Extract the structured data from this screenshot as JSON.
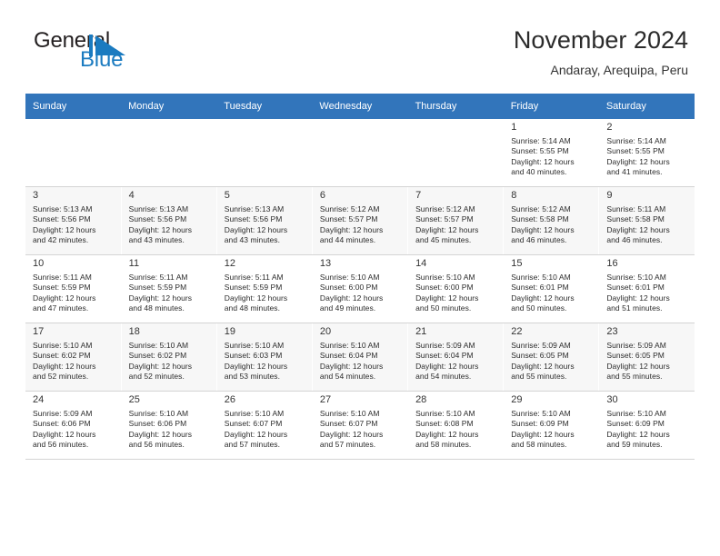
{
  "brand": {
    "name_part1": "General",
    "name_part2": "Blue",
    "logo_icon": "triangle-logo-icon",
    "accent_color": "#1b7bc0"
  },
  "header": {
    "title": "November 2024",
    "subtitle": "Andaray, Arequipa, Peru",
    "header_row_color": "#3275bb"
  },
  "weekdays": [
    "Sunday",
    "Monday",
    "Tuesday",
    "Wednesday",
    "Thursday",
    "Friday",
    "Saturday"
  ],
  "weeks": [
    [
      {
        "day": "",
        "sunrise": "",
        "sunset": "",
        "daylight1": "",
        "daylight2": ""
      },
      {
        "day": "",
        "sunrise": "",
        "sunset": "",
        "daylight1": "",
        "daylight2": ""
      },
      {
        "day": "",
        "sunrise": "",
        "sunset": "",
        "daylight1": "",
        "daylight2": ""
      },
      {
        "day": "",
        "sunrise": "",
        "sunset": "",
        "daylight1": "",
        "daylight2": ""
      },
      {
        "day": "",
        "sunrise": "",
        "sunset": "",
        "daylight1": "",
        "daylight2": ""
      },
      {
        "day": "1",
        "sunrise": "Sunrise: 5:14 AM",
        "sunset": "Sunset: 5:55 PM",
        "daylight1": "Daylight: 12 hours",
        "daylight2": "and 40 minutes."
      },
      {
        "day": "2",
        "sunrise": "Sunrise: 5:14 AM",
        "sunset": "Sunset: 5:55 PM",
        "daylight1": "Daylight: 12 hours",
        "daylight2": "and 41 minutes."
      }
    ],
    [
      {
        "day": "3",
        "sunrise": "Sunrise: 5:13 AM",
        "sunset": "Sunset: 5:56 PM",
        "daylight1": "Daylight: 12 hours",
        "daylight2": "and 42 minutes."
      },
      {
        "day": "4",
        "sunrise": "Sunrise: 5:13 AM",
        "sunset": "Sunset: 5:56 PM",
        "daylight1": "Daylight: 12 hours",
        "daylight2": "and 43 minutes."
      },
      {
        "day": "5",
        "sunrise": "Sunrise: 5:13 AM",
        "sunset": "Sunset: 5:56 PM",
        "daylight1": "Daylight: 12 hours",
        "daylight2": "and 43 minutes."
      },
      {
        "day": "6",
        "sunrise": "Sunrise: 5:12 AM",
        "sunset": "Sunset: 5:57 PM",
        "daylight1": "Daylight: 12 hours",
        "daylight2": "and 44 minutes."
      },
      {
        "day": "7",
        "sunrise": "Sunrise: 5:12 AM",
        "sunset": "Sunset: 5:57 PM",
        "daylight1": "Daylight: 12 hours",
        "daylight2": "and 45 minutes."
      },
      {
        "day": "8",
        "sunrise": "Sunrise: 5:12 AM",
        "sunset": "Sunset: 5:58 PM",
        "daylight1": "Daylight: 12 hours",
        "daylight2": "and 46 minutes."
      },
      {
        "day": "9",
        "sunrise": "Sunrise: 5:11 AM",
        "sunset": "Sunset: 5:58 PM",
        "daylight1": "Daylight: 12 hours",
        "daylight2": "and 46 minutes."
      }
    ],
    [
      {
        "day": "10",
        "sunrise": "Sunrise: 5:11 AM",
        "sunset": "Sunset: 5:59 PM",
        "daylight1": "Daylight: 12 hours",
        "daylight2": "and 47 minutes."
      },
      {
        "day": "11",
        "sunrise": "Sunrise: 5:11 AM",
        "sunset": "Sunset: 5:59 PM",
        "daylight1": "Daylight: 12 hours",
        "daylight2": "and 48 minutes."
      },
      {
        "day": "12",
        "sunrise": "Sunrise: 5:11 AM",
        "sunset": "Sunset: 5:59 PM",
        "daylight1": "Daylight: 12 hours",
        "daylight2": "and 48 minutes."
      },
      {
        "day": "13",
        "sunrise": "Sunrise: 5:10 AM",
        "sunset": "Sunset: 6:00 PM",
        "daylight1": "Daylight: 12 hours",
        "daylight2": "and 49 minutes."
      },
      {
        "day": "14",
        "sunrise": "Sunrise: 5:10 AM",
        "sunset": "Sunset: 6:00 PM",
        "daylight1": "Daylight: 12 hours",
        "daylight2": "and 50 minutes."
      },
      {
        "day": "15",
        "sunrise": "Sunrise: 5:10 AM",
        "sunset": "Sunset: 6:01 PM",
        "daylight1": "Daylight: 12 hours",
        "daylight2": "and 50 minutes."
      },
      {
        "day": "16",
        "sunrise": "Sunrise: 5:10 AM",
        "sunset": "Sunset: 6:01 PM",
        "daylight1": "Daylight: 12 hours",
        "daylight2": "and 51 minutes."
      }
    ],
    [
      {
        "day": "17",
        "sunrise": "Sunrise: 5:10 AM",
        "sunset": "Sunset: 6:02 PM",
        "daylight1": "Daylight: 12 hours",
        "daylight2": "and 52 minutes."
      },
      {
        "day": "18",
        "sunrise": "Sunrise: 5:10 AM",
        "sunset": "Sunset: 6:02 PM",
        "daylight1": "Daylight: 12 hours",
        "daylight2": "and 52 minutes."
      },
      {
        "day": "19",
        "sunrise": "Sunrise: 5:10 AM",
        "sunset": "Sunset: 6:03 PM",
        "daylight1": "Daylight: 12 hours",
        "daylight2": "and 53 minutes."
      },
      {
        "day": "20",
        "sunrise": "Sunrise: 5:10 AM",
        "sunset": "Sunset: 6:04 PM",
        "daylight1": "Daylight: 12 hours",
        "daylight2": "and 54 minutes."
      },
      {
        "day": "21",
        "sunrise": "Sunrise: 5:09 AM",
        "sunset": "Sunset: 6:04 PM",
        "daylight1": "Daylight: 12 hours",
        "daylight2": "and 54 minutes."
      },
      {
        "day": "22",
        "sunrise": "Sunrise: 5:09 AM",
        "sunset": "Sunset: 6:05 PM",
        "daylight1": "Daylight: 12 hours",
        "daylight2": "and 55 minutes."
      },
      {
        "day": "23",
        "sunrise": "Sunrise: 5:09 AM",
        "sunset": "Sunset: 6:05 PM",
        "daylight1": "Daylight: 12 hours",
        "daylight2": "and 55 minutes."
      }
    ],
    [
      {
        "day": "24",
        "sunrise": "Sunrise: 5:09 AM",
        "sunset": "Sunset: 6:06 PM",
        "daylight1": "Daylight: 12 hours",
        "daylight2": "and 56 minutes."
      },
      {
        "day": "25",
        "sunrise": "Sunrise: 5:10 AM",
        "sunset": "Sunset: 6:06 PM",
        "daylight1": "Daylight: 12 hours",
        "daylight2": "and 56 minutes."
      },
      {
        "day": "26",
        "sunrise": "Sunrise: 5:10 AM",
        "sunset": "Sunset: 6:07 PM",
        "daylight1": "Daylight: 12 hours",
        "daylight2": "and 57 minutes."
      },
      {
        "day": "27",
        "sunrise": "Sunrise: 5:10 AM",
        "sunset": "Sunset: 6:07 PM",
        "daylight1": "Daylight: 12 hours",
        "daylight2": "and 57 minutes."
      },
      {
        "day": "28",
        "sunrise": "Sunrise: 5:10 AM",
        "sunset": "Sunset: 6:08 PM",
        "daylight1": "Daylight: 12 hours",
        "daylight2": "and 58 minutes."
      },
      {
        "day": "29",
        "sunrise": "Sunrise: 5:10 AM",
        "sunset": "Sunset: 6:09 PM",
        "daylight1": "Daylight: 12 hours",
        "daylight2": "and 58 minutes."
      },
      {
        "day": "30",
        "sunrise": "Sunrise: 5:10 AM",
        "sunset": "Sunset: 6:09 PM",
        "daylight1": "Daylight: 12 hours",
        "daylight2": "and 59 minutes."
      }
    ]
  ]
}
